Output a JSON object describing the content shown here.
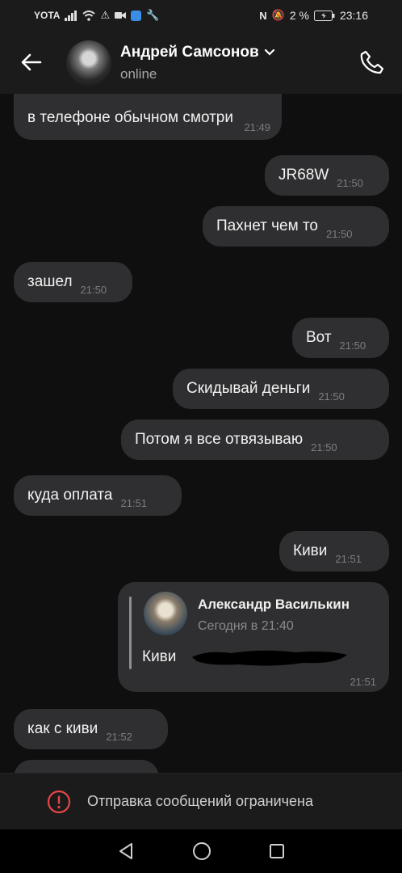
{
  "status_bar": {
    "carrier": "YOTA",
    "battery": "2 %",
    "time": "23:16"
  },
  "header": {
    "contact_name": "Андрей Самсонов",
    "contact_status": "online"
  },
  "messages": [
    {
      "text": "в телефоне обычном смотри",
      "time": "21:49",
      "side": "left"
    },
    {
      "text": "JR68W",
      "time": "21:50",
      "side": "right"
    },
    {
      "text": "Пахнет чем то",
      "time": "21:50",
      "side": "right"
    },
    {
      "text": "зашел",
      "time": "21:50",
      "side": "left"
    },
    {
      "text": "Вот",
      "time": "21:50",
      "side": "right"
    },
    {
      "text": "Скидывай деньги",
      "time": "21:50",
      "side": "right"
    },
    {
      "text": "Потом я все отвязываю",
      "time": "21:50",
      "side": "right"
    },
    {
      "text": "куда оплата",
      "time": "21:51",
      "side": "left"
    },
    {
      "text": "Киви",
      "time": "21:51",
      "side": "right"
    },
    {
      "text": "как с киви",
      "time": "21:52",
      "side": "left"
    }
  ],
  "forwarded": {
    "author": "Александр Василькин",
    "date": "Сегодня в 21:40",
    "text": "Киви",
    "time": "21:51"
  },
  "footer": {
    "restricted_text": "Отправка сообщений ограничена"
  },
  "colors": {
    "background": "#0f0f10",
    "bubble": "#2f2f31",
    "header": "#1b1b1c",
    "warning": "#e64646"
  },
  "icons": [
    "back-arrow-icon",
    "chevron-down-icon",
    "phone-icon",
    "warning-icon",
    "nav-back-icon",
    "nav-home-icon",
    "nav-recents-icon"
  ]
}
